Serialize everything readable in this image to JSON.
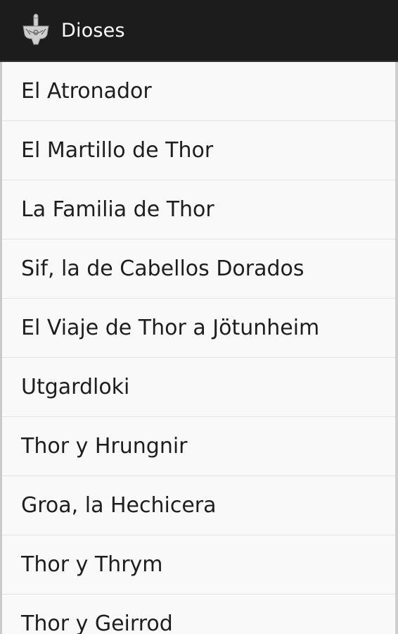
{
  "action_bar": {
    "title": "Dioses",
    "icon": "mjolnir-hammer-icon"
  },
  "list": {
    "items": [
      {
        "label": "El Atronador"
      },
      {
        "label": "El Martillo de Thor"
      },
      {
        "label": "La Familia de Thor"
      },
      {
        "label": "Sif, la de Cabellos Dorados"
      },
      {
        "label": "El Viaje de Thor a Jötunheim"
      },
      {
        "label": "Utgardloki"
      },
      {
        "label": "Thor y Hrungnir"
      },
      {
        "label": "Groa, la Hechicera"
      },
      {
        "label": "Thor y Thrym"
      },
      {
        "label": "Thor y Geirrod"
      }
    ]
  },
  "colors": {
    "action_bar_bg": "#1c1c1c",
    "list_bg": "#f8f8f8",
    "text": "#1e1e1e",
    "divider": "#e3e3e3"
  }
}
